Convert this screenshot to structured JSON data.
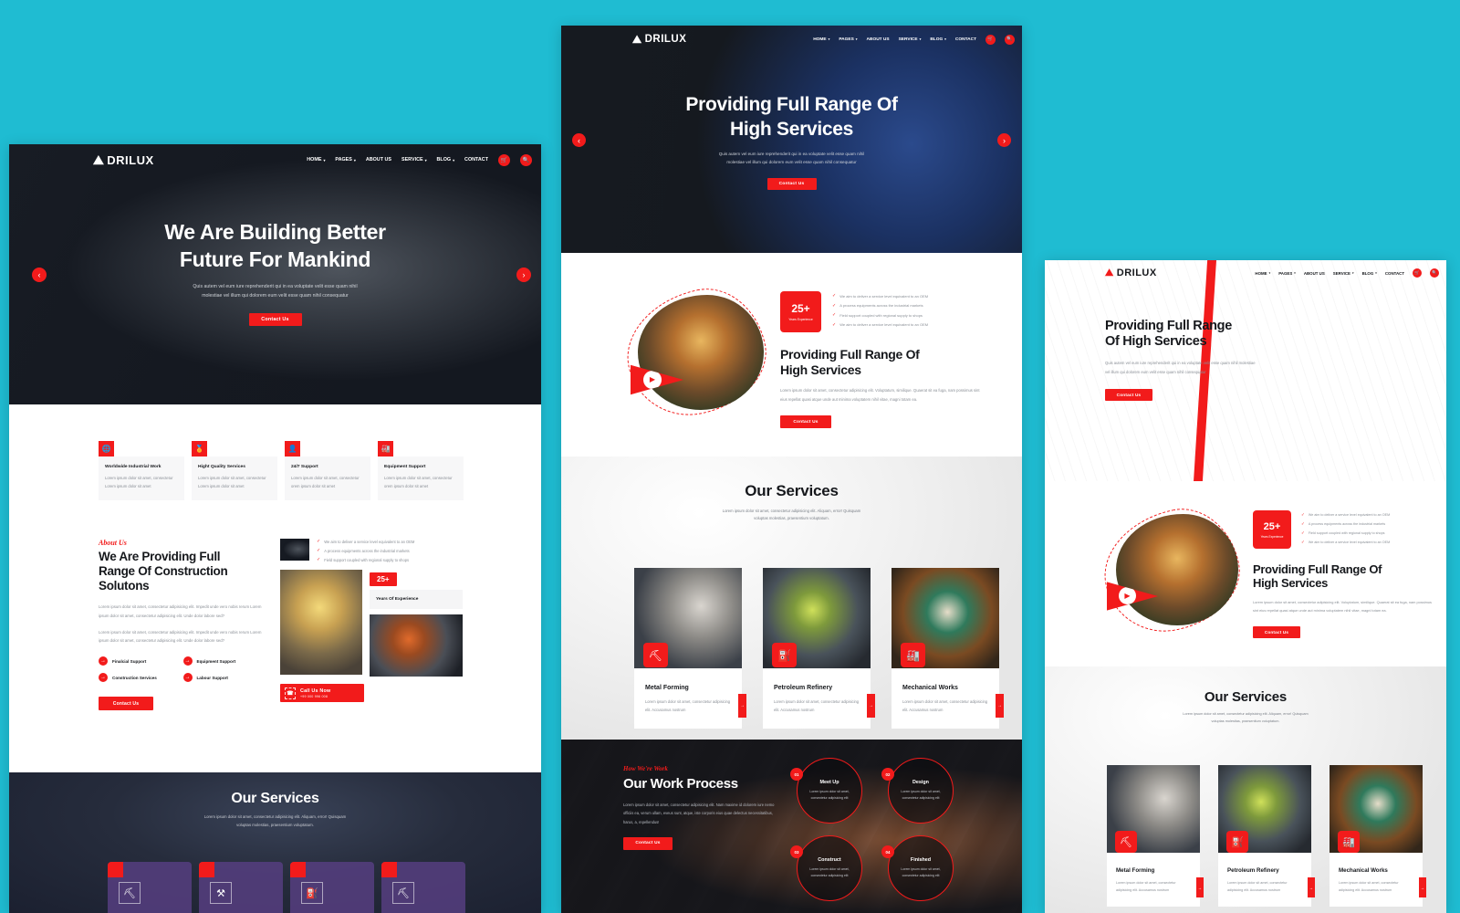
{
  "page": {
    "background_color": "#1fbcd2",
    "accent_color": "#f21b1b",
    "dark_color": "#16181c"
  },
  "brand": {
    "name": "DRILUX",
    "logo_icon": "oil-rig-icon"
  },
  "nav": {
    "items": [
      {
        "label": "HOME",
        "has_dropdown": true
      },
      {
        "label": "PAGES",
        "has_dropdown": true
      },
      {
        "label": "ABOUT US",
        "has_dropdown": false
      },
      {
        "label": "SERVICE",
        "has_dropdown": true
      },
      {
        "label": "BLOG",
        "has_dropdown": true
      },
      {
        "label": "CONTACT",
        "has_dropdown": false
      }
    ],
    "cart_icon": "cart-icon",
    "search_icon": "search-icon",
    "caret": "▾"
  },
  "mockup1": {
    "hero": {
      "title_line1": "We Are Building Better",
      "title_line2": "Future For Mankind",
      "paragraph_line1": "Quis autem vel eum iure reprehenderit qui in ea voluptate velit esse quam nihil",
      "paragraph_line2": "molestiae vel illum qui dolorem eum velit esse quam nihil consequatur",
      "cta_label": "Contact Us",
      "prev_icon": "chevron-left-icon",
      "next_icon": "chevron-right-icon",
      "prev_glyph": "‹",
      "next_glyph": "›"
    },
    "features": [
      {
        "icon": "worldwide-icon",
        "glyph": "🌐",
        "title": "Worldwide Industrial Work",
        "text": "Lorem ipsum dolor sit amet, consectetur Lorem ipsum dolor sit amet"
      },
      {
        "icon": "quality-badge-icon",
        "glyph": "🏅",
        "title": "Hight Quality Services",
        "text": "Lorem ipsum dolor sit amet, consectetur Lorem ipsum dolor sit amet"
      },
      {
        "icon": "support-agent-icon",
        "glyph": "👤",
        "title": "24/7 Support",
        "text": "Lorem ipsum dolor sit amet, consectetur orem ipsum dolor sit amet"
      },
      {
        "icon": "equipment-icon",
        "glyph": "🏭",
        "title": "Equipment Support",
        "text": "Lorem ipsum dolor sit amet, consectetur orem ipsum dolor sit amet"
      }
    ],
    "about": {
      "eyebrow": "About Us",
      "title_line1": "We Are Providing Full",
      "title_line2": "Range Of Construction",
      "title_line3": "Solutons",
      "paragraph1": "Lorem ipsum dolor sit amet, consectetur adipisicing elit. Impedit unde vero nobis rerum Lorem ipsum dolor sit amet, consectetur adipisicing elit. Unde dolor labore sed?",
      "paragraph2": "Lorem ipsum dolor sit amet, consectetur adipisicing elit. Impedit unde vero nobis rerum Lorem ipsum dolor sit amet, consectetur adipisicing elit. Unde dolor labore sed?",
      "bullets": [
        "Finalcial Support",
        "Equipment Support",
        "Construction Services",
        "Labour Support"
      ],
      "cta_label": "Contact Us",
      "checks": [
        "We aim to deliver a service level equivalent to an OEM",
        "A process equipments across the industrial markets",
        "Field support coupled with regional supply to shops"
      ],
      "experience_number": "25+",
      "experience_label": "Years Of Experience",
      "call_title": "Call Us Now",
      "call_number": "+99 000 996 008",
      "call_icon": "phone-icon"
    },
    "services": {
      "title": "Our Services",
      "subtitle_line1": "Lorem ipsum dolor sit amet, consectetur adipisicing elit. Aliquam, error! Quisquam",
      "subtitle_line2": "voluptas molestias, praesentium voluptatum.",
      "cards": [
        {
          "icon": "excavator-icon",
          "glyph": "⛏"
        },
        {
          "icon": "drill-icon",
          "glyph": "⚒"
        },
        {
          "icon": "oil-pump-icon",
          "glyph": "⚙"
        },
        {
          "icon": "excavator-icon",
          "glyph": "⛏"
        }
      ]
    }
  },
  "mockup2": {
    "hero": {
      "title_line1": "Providing Full Range Of",
      "title_line2": "High Services",
      "paragraph_line1": "Quis autem vel eum iure reprehenderit qui in ea voluptate velit esse quam nihil",
      "paragraph_line2": "molestiae vel illum qui dolorem eum velit esse quam nihil consequatur",
      "cta_label": "Contact Us",
      "prev_glyph": "‹",
      "next_glyph": "›"
    },
    "about": {
      "experience_number": "25+",
      "experience_label": "Years Experience",
      "checks": [
        "We aim to deliver a service level equivalent to an OEM",
        "A process equipments across the industrial markets",
        "Field support coupled with regional supply to shops",
        "We aim to deliver a service level equivalent to an OEM"
      ],
      "title_line1": "Providing Full Range Of",
      "title_line2": "High Services",
      "paragraph": "Lorem ipsum dolor sit amet, consectetur adipisicing elit. Voluptatum, similique. Quaerat sit ea fuga, nam possimus sint eius repellat quasi atque unde aut minima voluptatem nihil vitae, magni totam ea.",
      "cta_label": "Contact Us",
      "play_icon": "play-button-icon",
      "play_glyph": "▶"
    },
    "services": {
      "title": "Our Services",
      "subtitle_line1": "Lorem ipsum dolor sit amet, consectetur adipisicing elit. Aliquam, error! Quisquam",
      "subtitle_line2": "voluptas molestias, praesentium voluptatum.",
      "cards": [
        {
          "icon": "metal-forming-icon",
          "glyph": "⛏",
          "title": "Metal Forming",
          "text": "Lorem ipsum dolor sit amet, consectetur adipisicing elit. Accusamus nostrum"
        },
        {
          "icon": "petroleum-refinery-icon",
          "glyph": "⚙",
          "title": "Petroleum Refinery",
          "text": "Lorem ipsum dolor sit amet, consectetur adipisicing elit. Accusamus nostrum"
        },
        {
          "icon": "mechanical-works-icon",
          "glyph": "🏭",
          "title": "Mechanical Works",
          "text": "Lorem ipsum dolor sit amet, consectetur adipisicing elit. Accusamus nostrum"
        }
      ]
    },
    "process": {
      "eyebrow": "How We're Work",
      "title": "Our Work Process",
      "paragraph": "Lorem ipsum dolor sit amet, consectetur adipisicing elit. Nam maxime id dolorem iure nemo officiis ea, verum ullam, eveus sunt, atque, iste corporis eius quae delectus necessitatibus, harus, a, repellendus!",
      "cta_label": "Contact Us",
      "steps": [
        {
          "number": "01",
          "title": "Meet Up",
          "text": "Lorem ipsum dolor sit amet, consectetur adipisicing elit"
        },
        {
          "number": "02",
          "title": "Design",
          "text": "Lorem ipsum dolor sit amet, consectetur adipisicing elit"
        },
        {
          "number": "03",
          "title": "Construct",
          "text": "Lorem ipsum dolor sit amet, consectetur adipisicing elit"
        },
        {
          "number": "04",
          "title": "Finished",
          "text": "Lorem ipsum dolor sit amet, consectetur adipisicing elit"
        }
      ]
    }
  },
  "mockup3": {
    "hero": {
      "title_line1": "Providing Full Range",
      "title_line2": "Of High Services",
      "paragraph": "Quis autem vel eum iure reprehenderit qui in ea voluptate velit esse quam nihil molestiae vel illum qui dolorem eum velit esse quam nihil consequatur",
      "cta_label": "Contact Us"
    },
    "about": {
      "experience_number": "25+",
      "experience_label": "Years Experience",
      "checks": [
        "We aim to deliver a service level equivalent to an OEM",
        "A process equipments across the industrial markets",
        "Field support coupled with regional supply to shops",
        "We aim to deliver a service level equivalent to an OEM"
      ],
      "title_line1": "Providing Full Range Of",
      "title_line2": "High Services",
      "paragraph": "Lorem ipsum dolor sit amet, consectetur adipisicing elit. Voluptatum, similique. Quaerat sit ea fuga, nam possimus sint eius repellat quasi atque unde aut minima voluptatem nihil vitae, magni totam ea.",
      "cta_label": "Contact Us",
      "play_glyph": "▶"
    },
    "services": {
      "title": "Our Services",
      "subtitle_line1": "Lorem ipsum dolor sit amet, consectetur adipisicing elit. Aliquam, error! Quisquam",
      "subtitle_line2": "voluptas molestias, praesentium voluptatum.",
      "cards": [
        {
          "icon": "metal-forming-icon",
          "glyph": "⛏",
          "title": "Metal Forming",
          "text": "Lorem ipsum dolor sit amet, consectetur adipisicing elit. Accusamus nostrum"
        },
        {
          "icon": "petroleum-refinery-icon",
          "glyph": "⚙",
          "title": "Petroleum Refinery",
          "text": "Lorem ipsum dolor sit amet, consectetur adipisicing elit. Accusamus nostrum"
        },
        {
          "icon": "mechanical-works-icon",
          "glyph": "🏭",
          "title": "Mechanical Works",
          "text": "Lorem ipsum dolor sit amet, consectetur adipisicing elit. Accusamus nostrum"
        }
      ]
    }
  }
}
